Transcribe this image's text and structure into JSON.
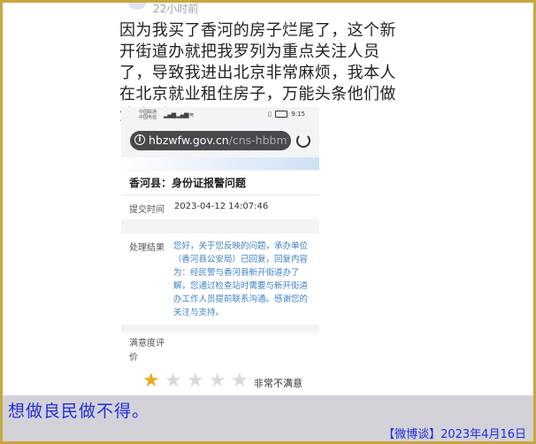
{
  "post": {
    "time": "22小时前",
    "text": "因为我买了香河的房子烂尾了，这个新开街道办就把我罗列为重点关注人员了，导致我进出北京非常麻烦，我本人在北京就业租住房子，万能头条他们做法合适吗？？？"
  },
  "phone": {
    "carrier1": "中国联通",
    "carrier2": "中国电信",
    "signal": "▂▄▆ ▂▄▆ ≋",
    "time": "9:15",
    "url_host": "hbzwfw.gov.cn",
    "url_path": "/cns-hbbmfw-w",
    "title": "香河县：身份证报警问题",
    "submit_label": "提交时间",
    "submit_time": "2023-04-12 14:07:46",
    "result_label": "处理结果",
    "result_text": "您好，关于您反映的问题，承办单位（香河县公安局）已回复，回复内容为：经民警与香河县新开街道办了解，您通过检查站时需要与新开街道办工作人员提前联系沟通。感谢您的关注与支持。",
    "rating_label": "满意度评价",
    "rating_value": 1,
    "rating_max": 5,
    "rating_text": "非常不满意"
  },
  "footer": {
    "caption": "想做良民做不得。",
    "source": "【微博谈】2023年4月16日"
  },
  "colors": {
    "frame": "#c9a63f",
    "caption": "#1f2ee0",
    "caption_bg": "#d3d2d9",
    "result_text": "#3d82c4",
    "star_on": "#f0a81e"
  }
}
